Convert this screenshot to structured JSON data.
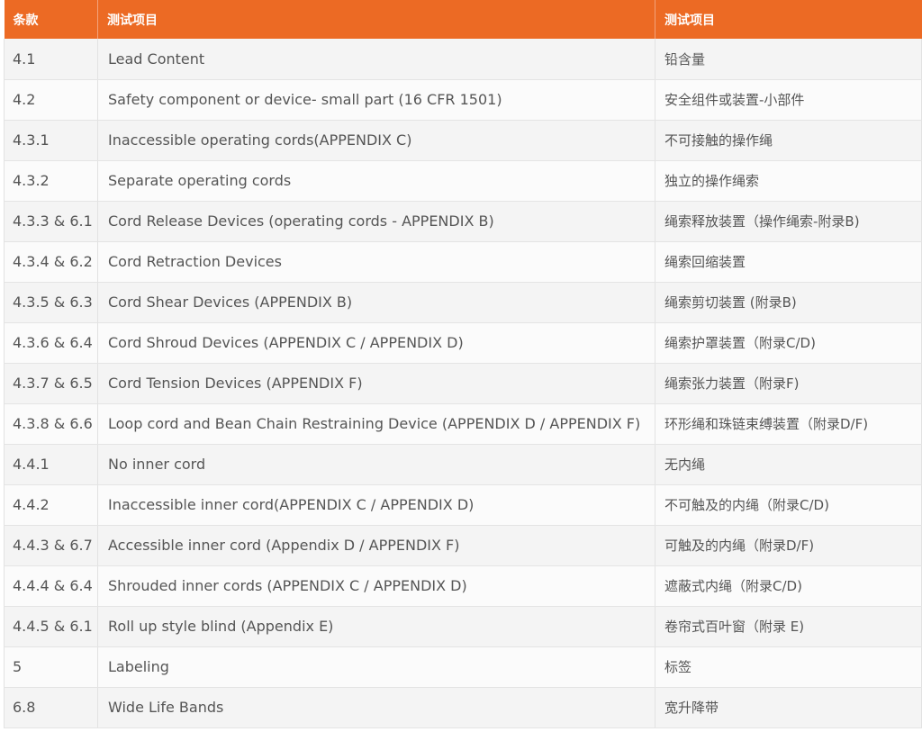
{
  "table": {
    "headers": [
      "条款",
      "测试项目",
      "测试项目"
    ],
    "rows": [
      [
        "4.1",
        "Lead Content",
        "铅含量"
      ],
      [
        "4.2",
        "Safety component or device- small part (16 CFR 1501)",
        "安全组件或装置-小部件"
      ],
      [
        "4.3.1",
        "Inaccessible operating cords(APPENDIX C)",
        "不可接触的操作绳"
      ],
      [
        "4.3.2",
        "Separate operating cords",
        "独立的操作绳索"
      ],
      [
        "4.3.3 & 6.1",
        "Cord Release Devices (operating cords - APPENDIX B)",
        "绳索释放装置（操作绳索-附录B)"
      ],
      [
        "4.3.4 & 6.2",
        "Cord Retraction Devices",
        "绳索回缩装置"
      ],
      [
        "4.3.5 & 6.3",
        "Cord Shear Devices (APPENDIX B)",
        "绳索剪切装置 (附录B)"
      ],
      [
        "4.3.6 & 6.4",
        "Cord Shroud Devices (APPENDIX C / APPENDIX D)",
        "绳索护罩装置（附录C/D)"
      ],
      [
        "4.3.7 & 6.5",
        "Cord Tension Devices (APPENDIX F)",
        "绳索张力装置（附录F)"
      ],
      [
        "4.3.8 & 6.6",
        "Loop cord and Bean Chain Restraining Device (APPENDIX D / APPENDIX F)",
        "环形绳和珠链束缚装置（附录D/F)"
      ],
      [
        "4.4.1",
        "No inner cord",
        "无内绳"
      ],
      [
        "4.4.2",
        "Inaccessible inner cord(APPENDIX C / APPENDIX D)",
        "不可触及的内绳（附录C/D)"
      ],
      [
        "4.4.3 & 6.7",
        "Accessible inner cord (Appendix D / APPENDIX F)",
        "可触及的内绳（附录D/F)"
      ],
      [
        "4.4.4 & 6.4",
        "Shrouded inner cords (APPENDIX C / APPENDIX D)",
        "遮蔽式内绳（附录C/D)"
      ],
      [
        "4.4.5 & 6.1",
        "Roll up style blind (Appendix E)",
        "卷帘式百叶窗（附录 E)"
      ],
      [
        "5",
        "Labeling",
        "标签"
      ],
      [
        "6.8",
        "Wide Life Bands",
        "宽升降带"
      ]
    ]
  },
  "colors": {
    "header_bg": "#ec6a24",
    "header_text": "#ffffff",
    "row_text": "#555555"
  }
}
